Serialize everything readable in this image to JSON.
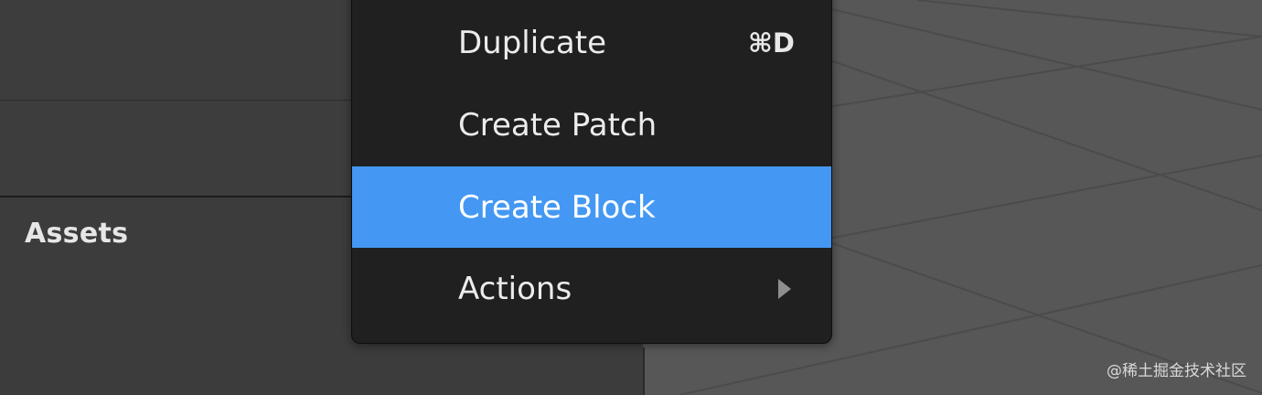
{
  "assets_panel": {
    "title": "Assets"
  },
  "context_menu": {
    "items": [
      {
        "label": "Duplicate",
        "shortcut": "⌘D"
      },
      {
        "label": "Create Patch"
      },
      {
        "label": "Create Block",
        "highlighted": true
      },
      {
        "label": "Actions",
        "has_submenu": true
      }
    ]
  },
  "viewport": {
    "background_color": "#575757",
    "grid_color": "#4a4a4a"
  },
  "colors": {
    "menu_background": "#202020",
    "highlight": "#4498f3",
    "panel_background": "#3d3d3d"
  },
  "watermark": "@稀土掘金技术社区"
}
